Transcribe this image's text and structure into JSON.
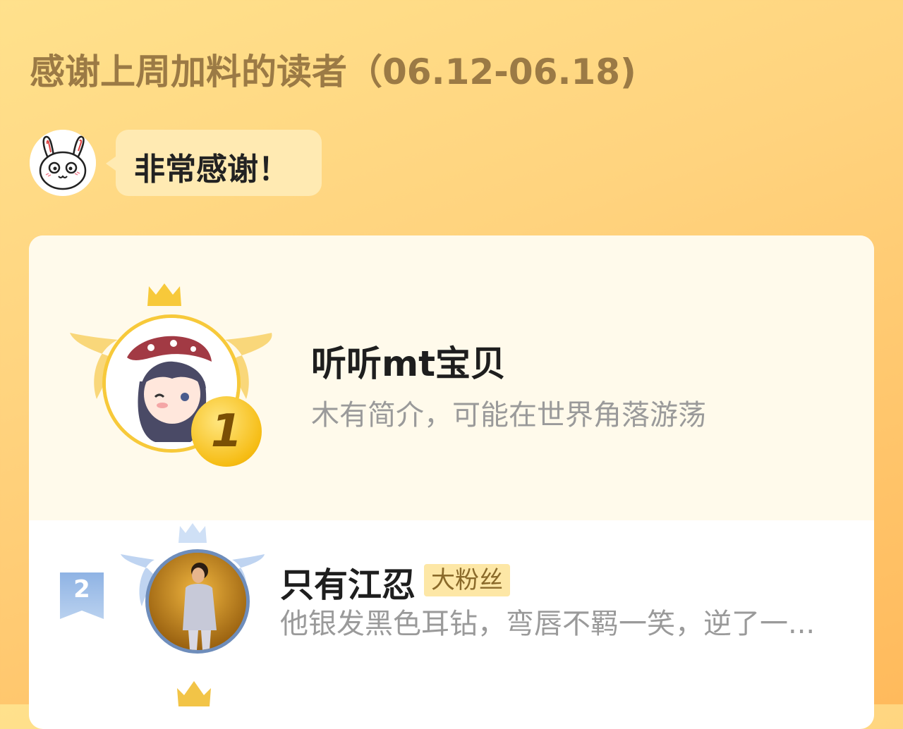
{
  "header": {
    "title": "感谢上周加料的读者（06.12-06.18)"
  },
  "greeting": {
    "mascot_icon": "rabbit-mascot-icon",
    "message": "非常感谢！"
  },
  "ranking": [
    {
      "rank": "1",
      "name": "听听mt宝贝",
      "bio": "木有简介，可能在世界角落游荡",
      "emblem_color": "#f7c93a"
    },
    {
      "rank": "2",
      "name": "只有江忍",
      "badge": "大粉丝",
      "bio": "他银发黑色耳钻，弯唇不羁一笑，逆了一...",
      "emblem_color": "#9dbbe6"
    }
  ],
  "colors": {
    "accent_gold": "#f7c93a",
    "title_brown": "#9b7a45",
    "bio_gray": "#9a9a9a",
    "badge_bg": "#fde7a6"
  }
}
